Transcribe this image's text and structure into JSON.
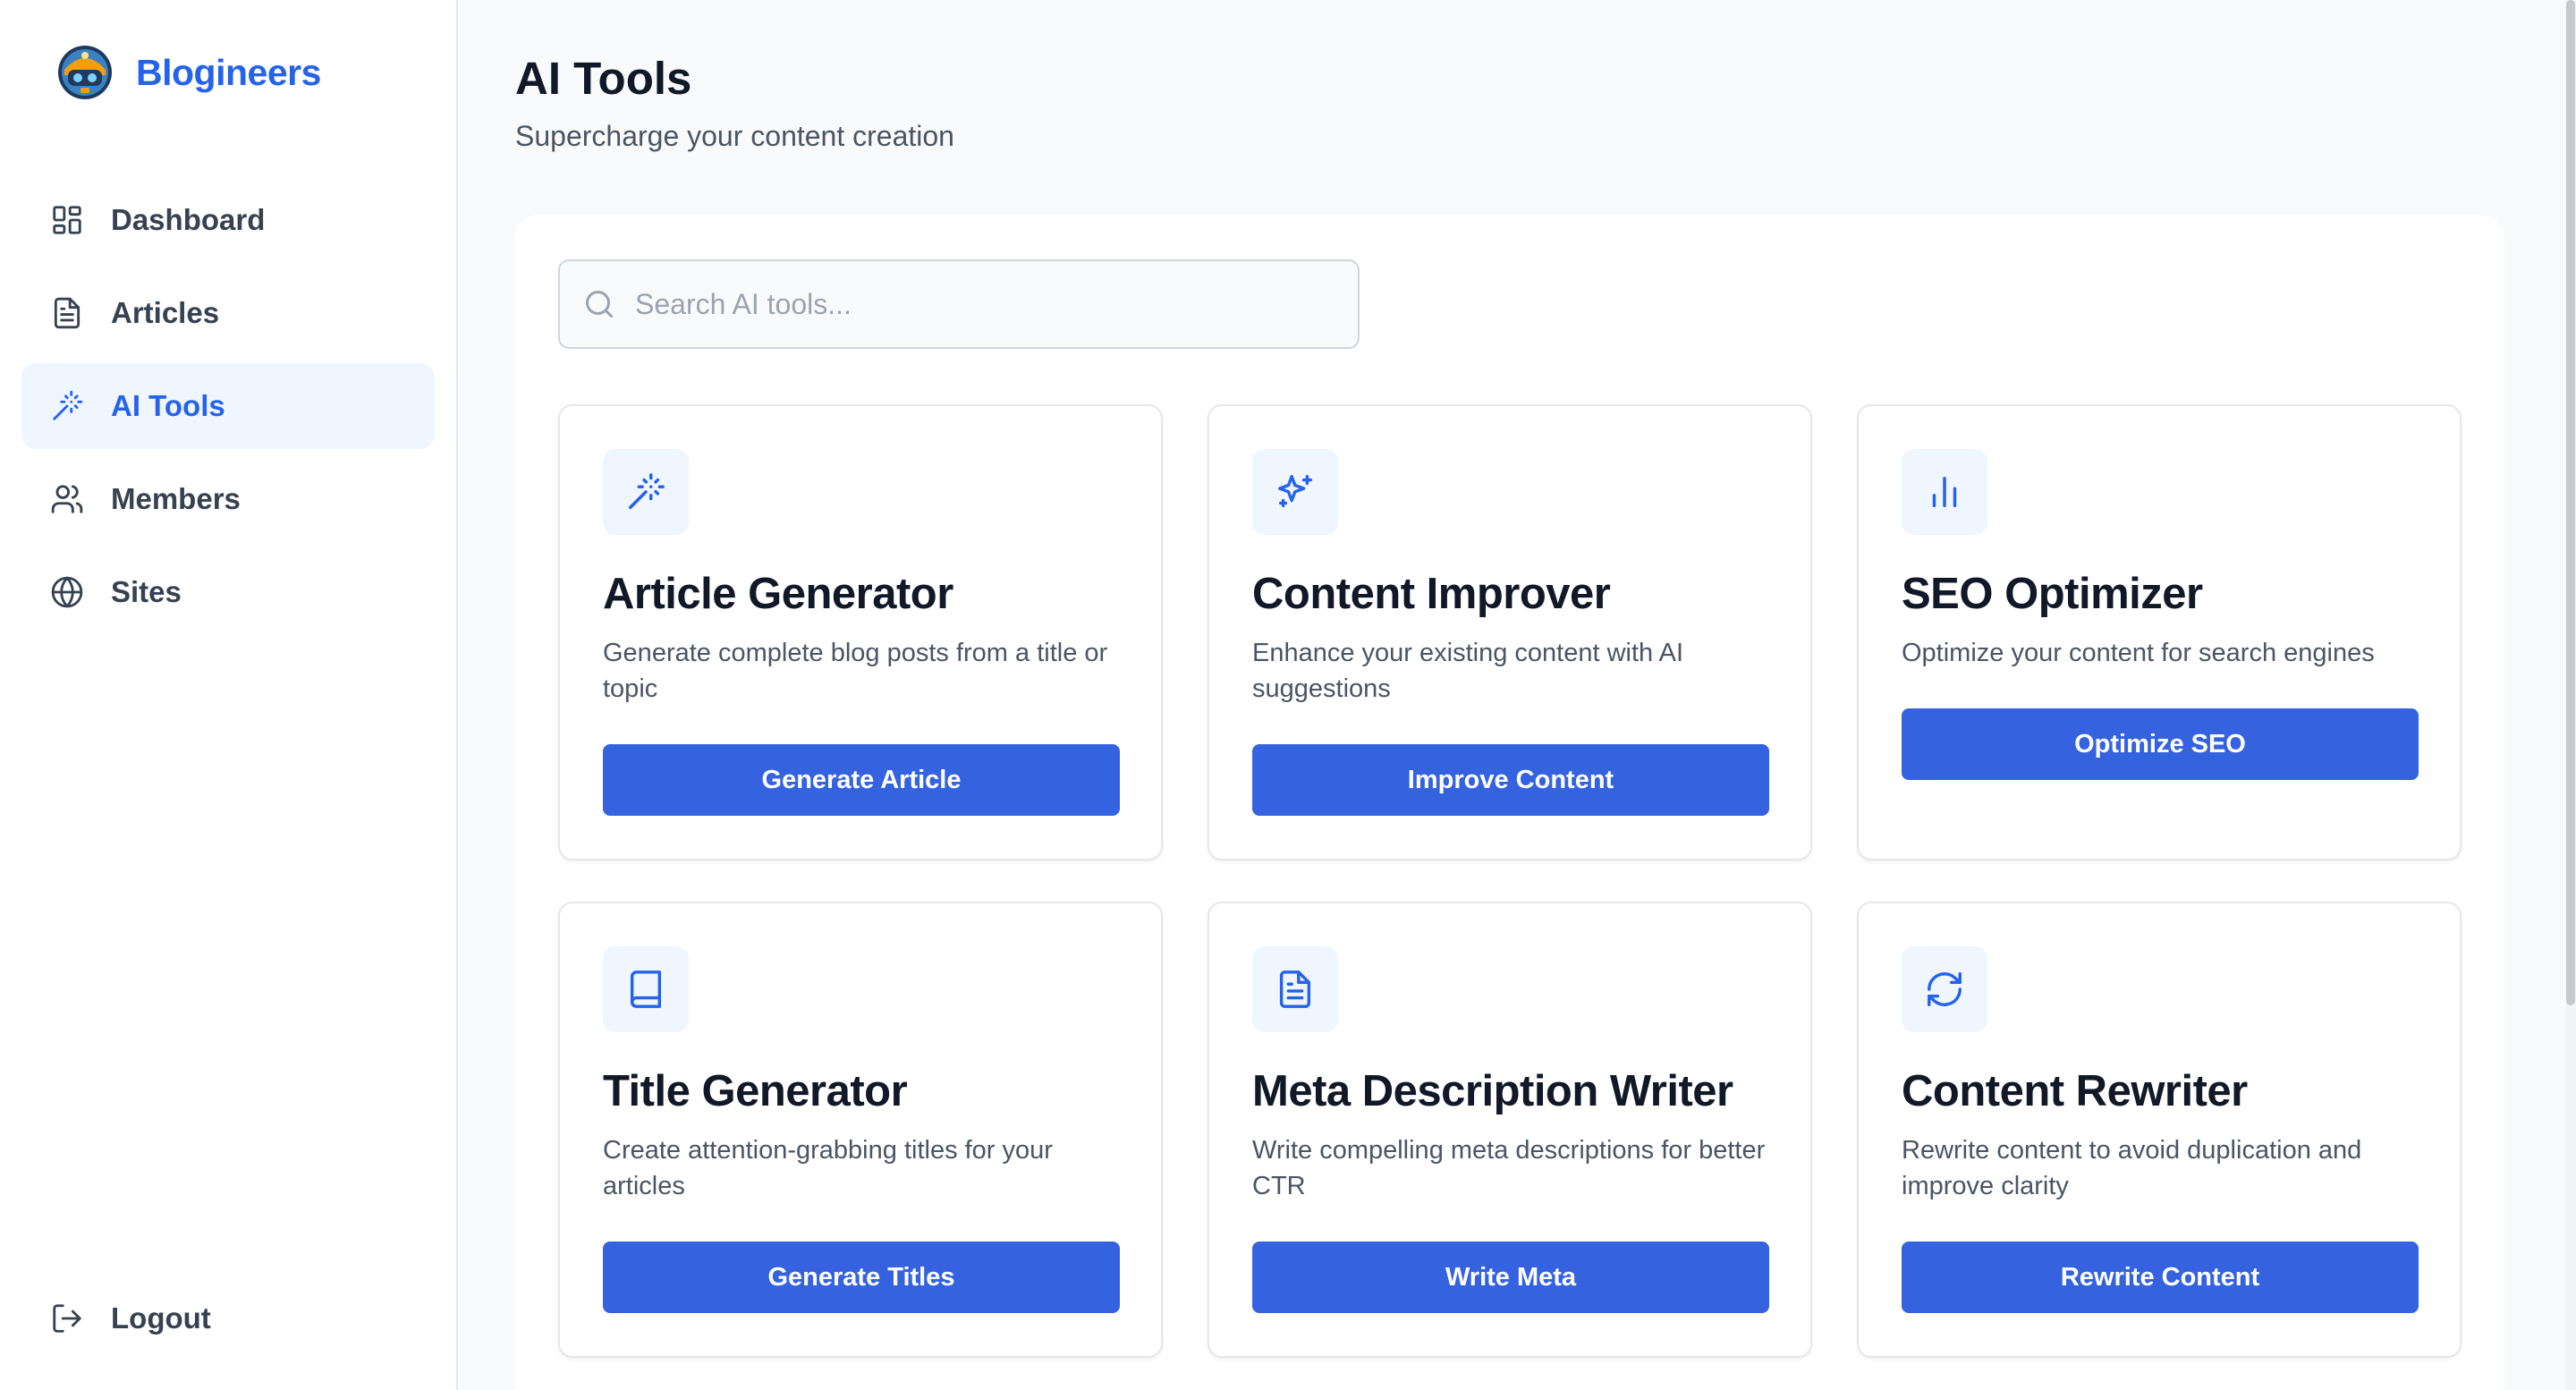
{
  "brand": {
    "name": "Blogineers"
  },
  "sidebar": {
    "items": [
      {
        "label": "Dashboard",
        "icon": "dashboard-icon",
        "active": false
      },
      {
        "label": "Articles",
        "icon": "document-icon",
        "active": false
      },
      {
        "label": "AI Tools",
        "icon": "magic-wand-icon",
        "active": true
      },
      {
        "label": "Members",
        "icon": "users-icon",
        "active": false
      },
      {
        "label": "Sites",
        "icon": "globe-icon",
        "active": false
      }
    ],
    "logout": {
      "label": "Logout",
      "icon": "logout-icon"
    }
  },
  "header": {
    "title": "AI Tools",
    "subtitle": "Supercharge your content creation"
  },
  "search": {
    "placeholder": "Search AI tools...",
    "value": ""
  },
  "tools": [
    {
      "title": "Article Generator",
      "description": "Generate complete blog posts from a title or topic",
      "button": "Generate Article",
      "icon": "magic-wand-icon"
    },
    {
      "title": "Content Improver",
      "description": "Enhance your existing content with AI suggestions",
      "button": "Improve Content",
      "icon": "sparkles-icon"
    },
    {
      "title": "SEO Optimizer",
      "description": "Optimize your content for search engines",
      "button": "Optimize SEO",
      "icon": "bar-chart-icon"
    },
    {
      "title": "Title Generator",
      "description": "Create attention-grabbing titles for your articles",
      "button": "Generate Titles",
      "icon": "book-icon"
    },
    {
      "title": "Meta Description Writer",
      "description": "Write compelling meta descriptions for better CTR",
      "button": "Write Meta",
      "icon": "file-text-icon"
    },
    {
      "title": "Content Rewriter",
      "description": "Rewrite content to avoid duplication and improve clarity",
      "button": "Rewrite Content",
      "icon": "refresh-icon"
    }
  ],
  "colors": {
    "accent": "#2563eb",
    "button": "#3563e0",
    "active_bg": "#eff6ff",
    "page_bg": "#f9fafb"
  }
}
